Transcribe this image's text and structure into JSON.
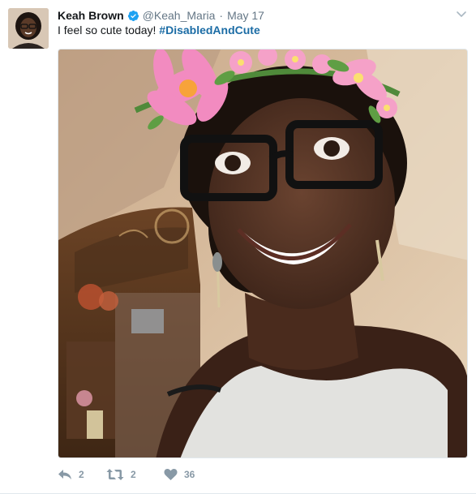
{
  "tweet": {
    "author_name": "Keah Brown",
    "author_handle": "@Keah_Maria",
    "separator": "·",
    "timestamp": "May 17",
    "text_plain": "I feel so cute today! ",
    "hashtag": "#DisabledAndCute",
    "reply_count": "2",
    "retweet_count": "2",
    "like_count": "36"
  },
  "icons": {
    "verified": "verified-badge-icon",
    "menu": "chevron-down-icon",
    "reply": "reply-icon",
    "retweet": "retweet-icon",
    "like": "heart-icon"
  },
  "colors": {
    "verified_blue": "#1da1f2",
    "hashtag": "#1b6ca5",
    "meta_gray": "#657786",
    "action_gray": "#8899a6"
  }
}
